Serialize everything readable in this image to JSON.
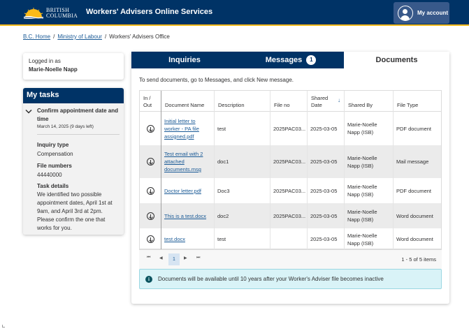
{
  "header": {
    "logo_line1": "BRITISH",
    "logo_line2": "COLUMBIA",
    "app_title": "Workers' Advisers Online Services",
    "account_label": "My account",
    "bg_color": "#003366",
    "accent_color": "#fcba19"
  },
  "breadcrumb": {
    "items": [
      "B.C. Home",
      "Ministry of Labour",
      "Workers' Advisers Office"
    ],
    "separator": "/"
  },
  "login": {
    "label": "Logged in as",
    "user": "Marie-Noelle Napp"
  },
  "tasks": {
    "heading": "My tasks",
    "task_title": "Confirm appointment date and time",
    "task_date": "March 14, 2025 (9 days left)",
    "inquiry_type_label": "Inquiry type",
    "inquiry_type_value": "Compensation",
    "file_numbers_label": "File numbers",
    "file_numbers_value": "44440000",
    "details_label": "Task details",
    "details_value": "We identified two possible appointment dates, April 1st at 9am, and April 3rd at 2pm. Please confirm the one that works for you."
  },
  "tabs": {
    "inquiries": "Inquiries",
    "messages": "Messages",
    "messages_count": "1",
    "documents": "Documents",
    "active": "documents"
  },
  "documents": {
    "instruction": "To send documents, go to Messages, and click New message.",
    "columns": {
      "in_out_1": "In /",
      "in_out_2": "Out",
      "name": "Document Name",
      "description": "Description",
      "file_no": "File no",
      "shared_date_1": "Shared",
      "shared_date_2": "Date",
      "shared_by": "Shared By",
      "file_type": "File Type"
    },
    "rows": [
      {
        "name": "Initial letter to worker - PA file assigned.pdf",
        "description": "test",
        "file_no": "2025PAC03...",
        "date": "2025-03-05",
        "shared_by": "Marie-Noelle Napp (ISB)",
        "file_type": "PDF document"
      },
      {
        "name": "Test email with 2 attached documents.msg",
        "description": "doc1",
        "file_no": "2025PAC03...",
        "date": "2025-03-05",
        "shared_by": "Marie-Noelle Napp (ISB)",
        "file_type": "Mail message"
      },
      {
        "name": "Doctor letter.pdf",
        "description": "Doc3",
        "file_no": "2025PAC03...",
        "date": "2025-03-05",
        "shared_by": "Marie-Noelle Napp (ISB)",
        "file_type": "PDF document"
      },
      {
        "name": "This is a test.docx",
        "description": "doc2",
        "file_no": "2025PAC03...",
        "date": "2025-03-05",
        "shared_by": "Marie-Noelle Napp (ISB)",
        "file_type": "Word document"
      },
      {
        "name": "test.docx",
        "description": "test",
        "file_no": "",
        "date": "2025-03-05",
        "shared_by": "Marie-Noelle Napp (ISB)",
        "file_type": "Word document"
      }
    ],
    "pager": {
      "current_page": "1",
      "info": "1 - 5 of 5 items"
    },
    "notice": "Documents will be available until 10 years after your Worker's Adviser file becomes inactive"
  }
}
